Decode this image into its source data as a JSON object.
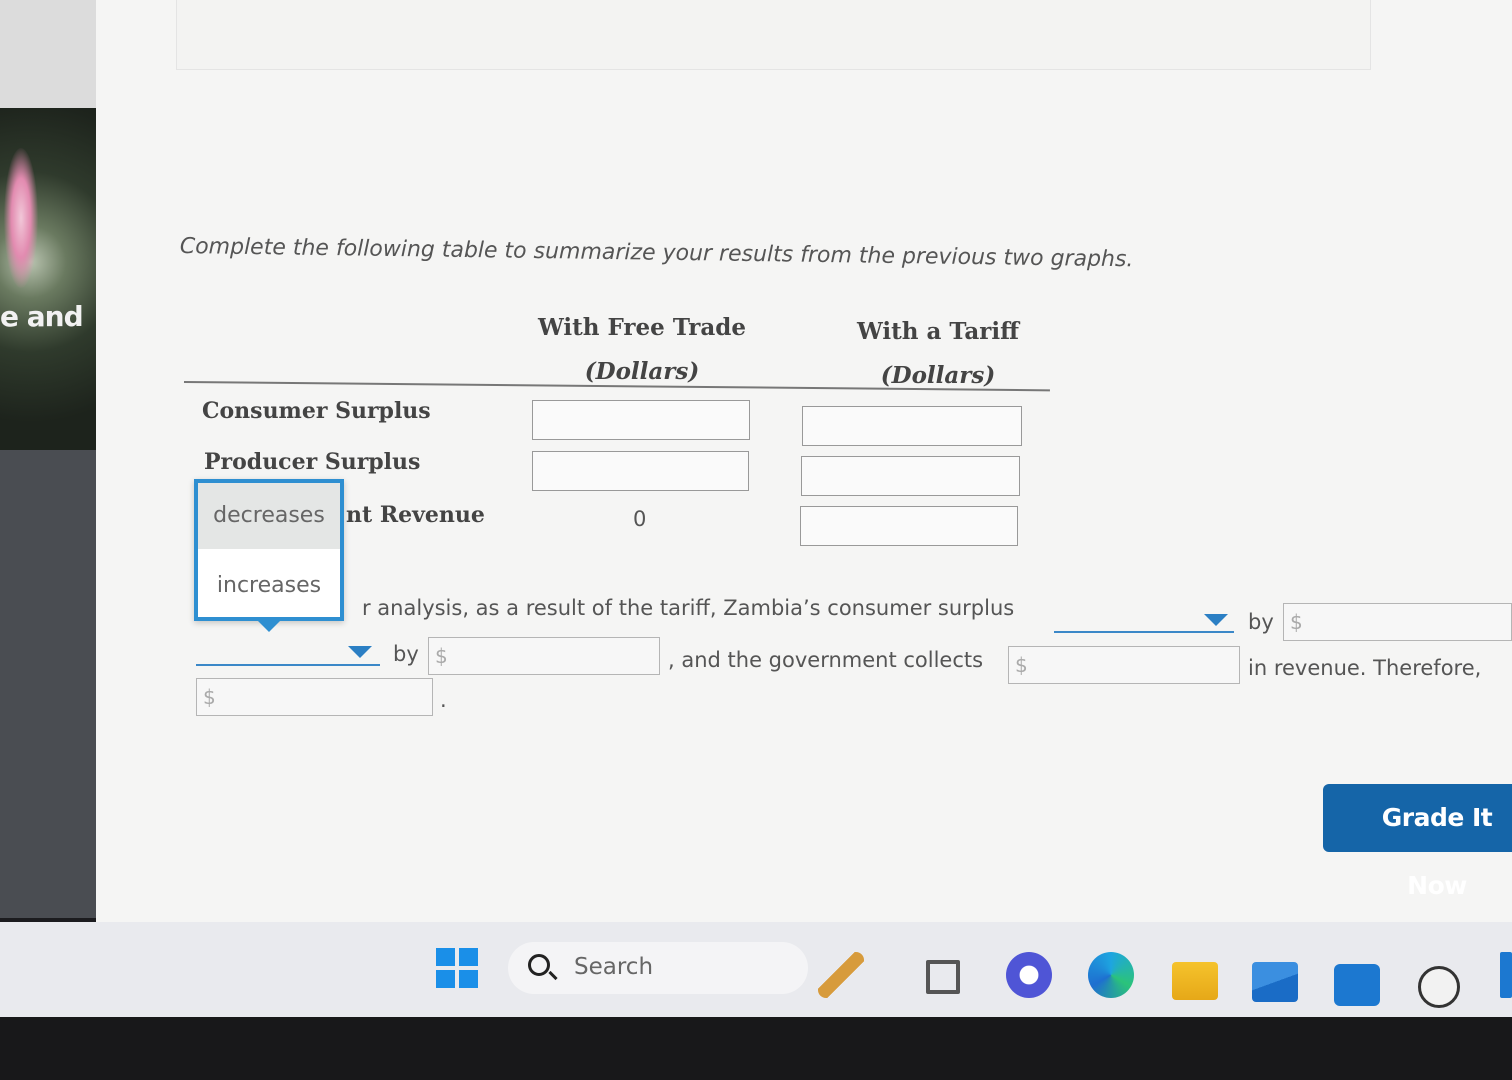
{
  "side": {
    "text": "e and"
  },
  "instruction": "Complete the following table to summarize your results from the previous two graphs.",
  "table": {
    "columns": [
      {
        "title": "With Free Trade",
        "unit": "(Dollars)"
      },
      {
        "title": "With a Tariff",
        "unit": "(Dollars)"
      }
    ],
    "rows": [
      {
        "label": "Consumer Surplus"
      },
      {
        "label": "Producer Surplus"
      },
      {
        "label": "nt Revenue",
        "free_trade_value": "0"
      }
    ]
  },
  "dropdown": {
    "options": [
      "decreases",
      "increases"
    ],
    "highlighted": "decreases"
  },
  "sentence": {
    "part1": "r analysis, as a result of the tariff, Zambia’s consumer surplus",
    "by1": "by",
    "by2": "by",
    "part2": ", and the government collects",
    "part3": "in revenue. Therefore,",
    "period": ".",
    "currency_prefix": "$"
  },
  "buttons": {
    "grade": "Grade It Now"
  },
  "taskbar": {
    "search_placeholder": "Search"
  },
  "colors": {
    "accent": "#2e8fd1",
    "button": "#1565a8",
    "windows_blue": "#1a8fe8"
  }
}
